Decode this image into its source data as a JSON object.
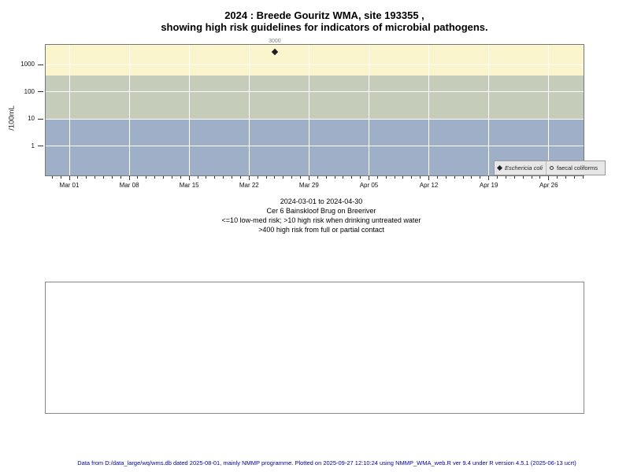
{
  "page": {
    "title_line1": "2024 : Breede Gouritz WMA, site 193355 ,",
    "title_line2": "showing high risk guidelines for indicators of microbial pathogens.",
    "footer": "Data from D:/data_large/wq/wms.db dated 2025-08-01, mainly NMMP programme. Plotted on 2025-09-27 12:10:24 using NMMP_WMA_web.R ver 9.4 under R version 4.5.1 (2025-06-13 ucrt)"
  },
  "captions": [
    "2024-03-01 to 2024-04-30",
    "Cer 6 Bainskloof Brug on Breeriver",
    "<=10 low-med risk; >10 high risk when drinking untreated water",
    ">400 high risk from full or partial contact"
  ],
  "legend": [
    {
      "symbol": "filled-diamond",
      "label": "Eschericia coli"
    },
    {
      "symbol": "open-circle",
      "label": "faecal coliforms"
    }
  ],
  "colors": {
    "band_high_risk_contact": "#fbf5cd",
    "band_high_risk_drinking": "#c5ccb9",
    "band_low_med_risk": "#a0afc8",
    "gridline": "#ffffff",
    "panel_border": "#777777",
    "marker": "#1d1d2b",
    "point_label": "#808080",
    "legend_bg": "#e7e7e7",
    "legend_border": "#999999",
    "footer_text": "#0000a0"
  },
  "chart_data": {
    "type": "scatter",
    "title": "2024 : Breede Gouritz WMA, site 193355 , showing high risk guidelines for indicators of microbial pathogens.",
    "subtitle": "2024-03-01 to 2024-04-30 | Cer 6 Bainskloof Brug on Breeriver",
    "y_axis": {
      "label": "/100mL",
      "scale": "log10",
      "ticks": [
        1,
        10,
        100,
        1000
      ],
      "approx_range": [
        0.08,
        5500
      ]
    },
    "x_axis": {
      "origin": "2024-03-01",
      "domain_days": [
        -2,
        60
      ],
      "tick_interval_days": 1,
      "label_interval_days": 7,
      "labels": [
        "Mar 01",
        "Mar 08",
        "Mar 15",
        "Mar 22",
        "Mar 29",
        "Apr 05",
        "Apr 12",
        "Apr 19",
        "Apr 26"
      ]
    },
    "grid": true,
    "legend_position": "bottom-right",
    "bands": [
      {
        "name": "high-risk-contact",
        "from": 400,
        "to": null,
        "color": "#fbf5cd",
        "meaning": ">400 high risk from full or partial contact"
      },
      {
        "name": "high-risk-drinking",
        "from": 10,
        "to": 400,
        "color": "#c5ccb9",
        "meaning": ">10 high risk when drinking untreated water"
      },
      {
        "name": "low-med-risk",
        "from": null,
        "to": 10,
        "color": "#a0afc8",
        "meaning": "<=10 low-med risk"
      }
    ],
    "series": [
      {
        "name": "Eschericia coli",
        "symbol": "filled-diamond",
        "points": [
          {
            "date_est": "2024-03-25",
            "value": 3000,
            "label": "3000"
          }
        ]
      },
      {
        "name": "faecal coliforms",
        "symbol": "open-circle",
        "points": []
      }
    ]
  }
}
